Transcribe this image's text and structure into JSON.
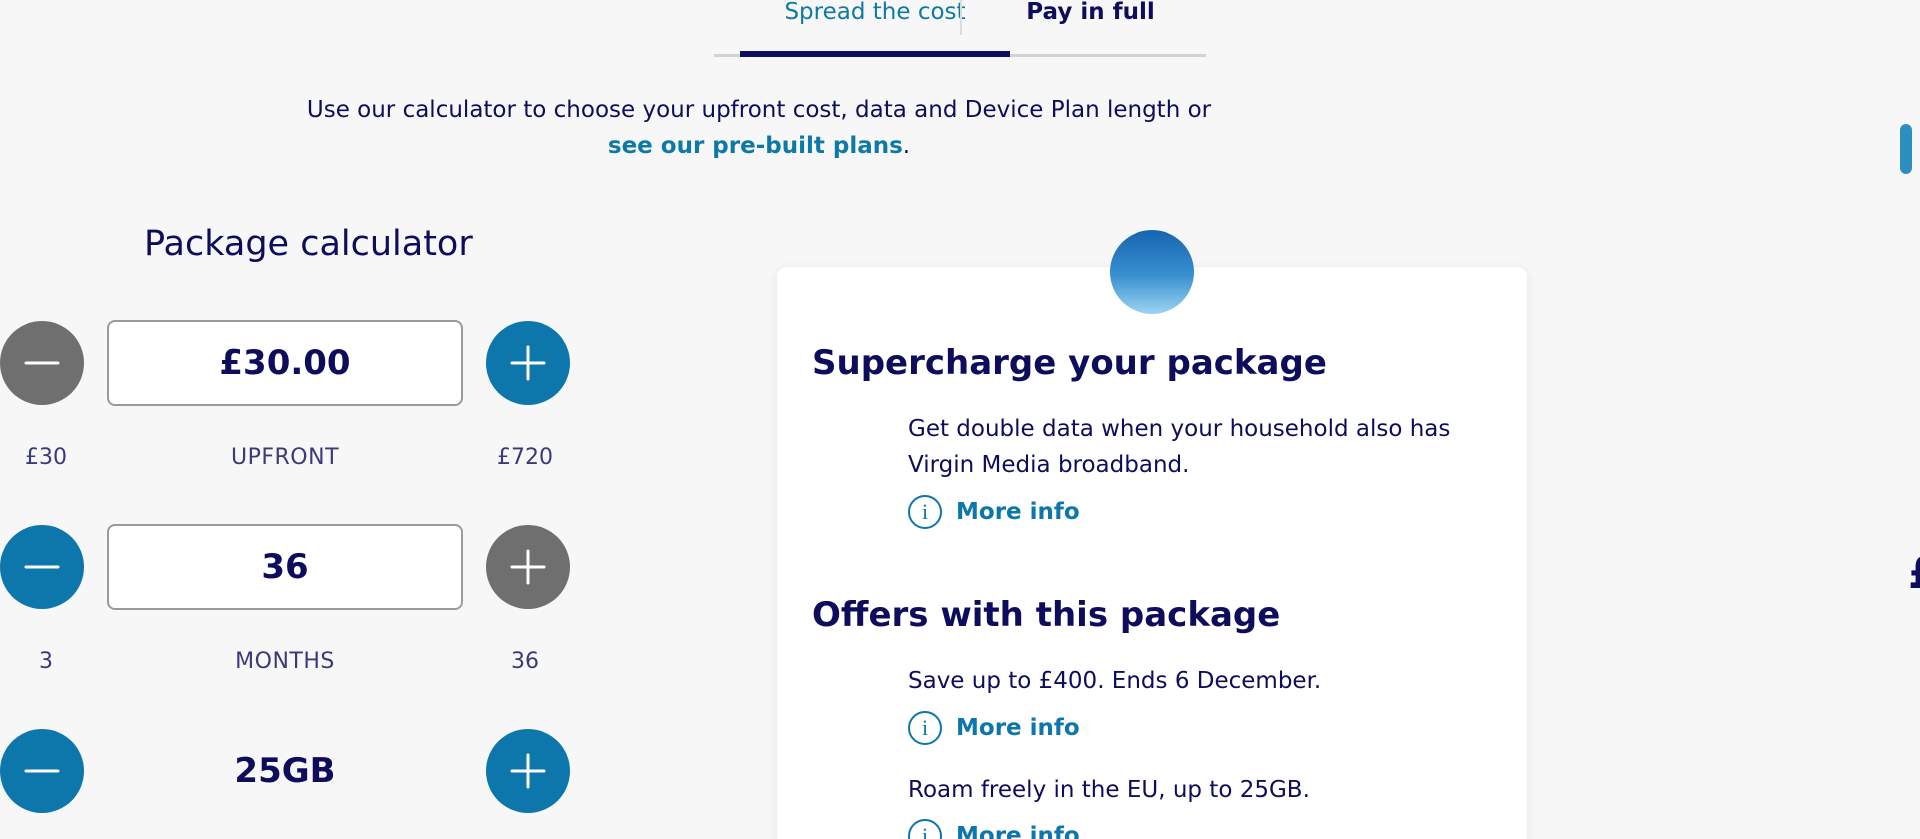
{
  "tabs": {
    "spread_label": "Spread the cost",
    "full_label": "Pay in full"
  },
  "intro": {
    "text_line1": "Use our calculator to choose your upfront cost, data and Device Plan length or",
    "link_text": "see our pre-built plans",
    "link_suffix": "."
  },
  "calculator": {
    "title": "Package calculator",
    "upfront": {
      "value": "£30.00",
      "min": "£30",
      "label": "UPFRONT",
      "max": "£720"
    },
    "months": {
      "value": "36",
      "min": "3",
      "label": "MONTHS",
      "max": "36"
    },
    "data": {
      "value": "25GB"
    }
  },
  "card": {
    "supercharge_title": "Supercharge your package",
    "supercharge_text": "Get double data when your household also has Virgin Media broadband.",
    "more_info": "More info",
    "offers_title": "Offers with this package",
    "offer1_text": "Save up to £400. Ends 6 December.",
    "offer2_text": "Roam freely in the EU, up to 25GB."
  },
  "edge_glyph": "£",
  "colors": {
    "navy": "#0d0d5c",
    "blue": "#0d76aa",
    "grey_button": "#6f6f6f",
    "background": "#f7f7f7"
  },
  "icons": {
    "minus": "minus-icon",
    "plus": "plus-icon",
    "info": "info-icon"
  }
}
